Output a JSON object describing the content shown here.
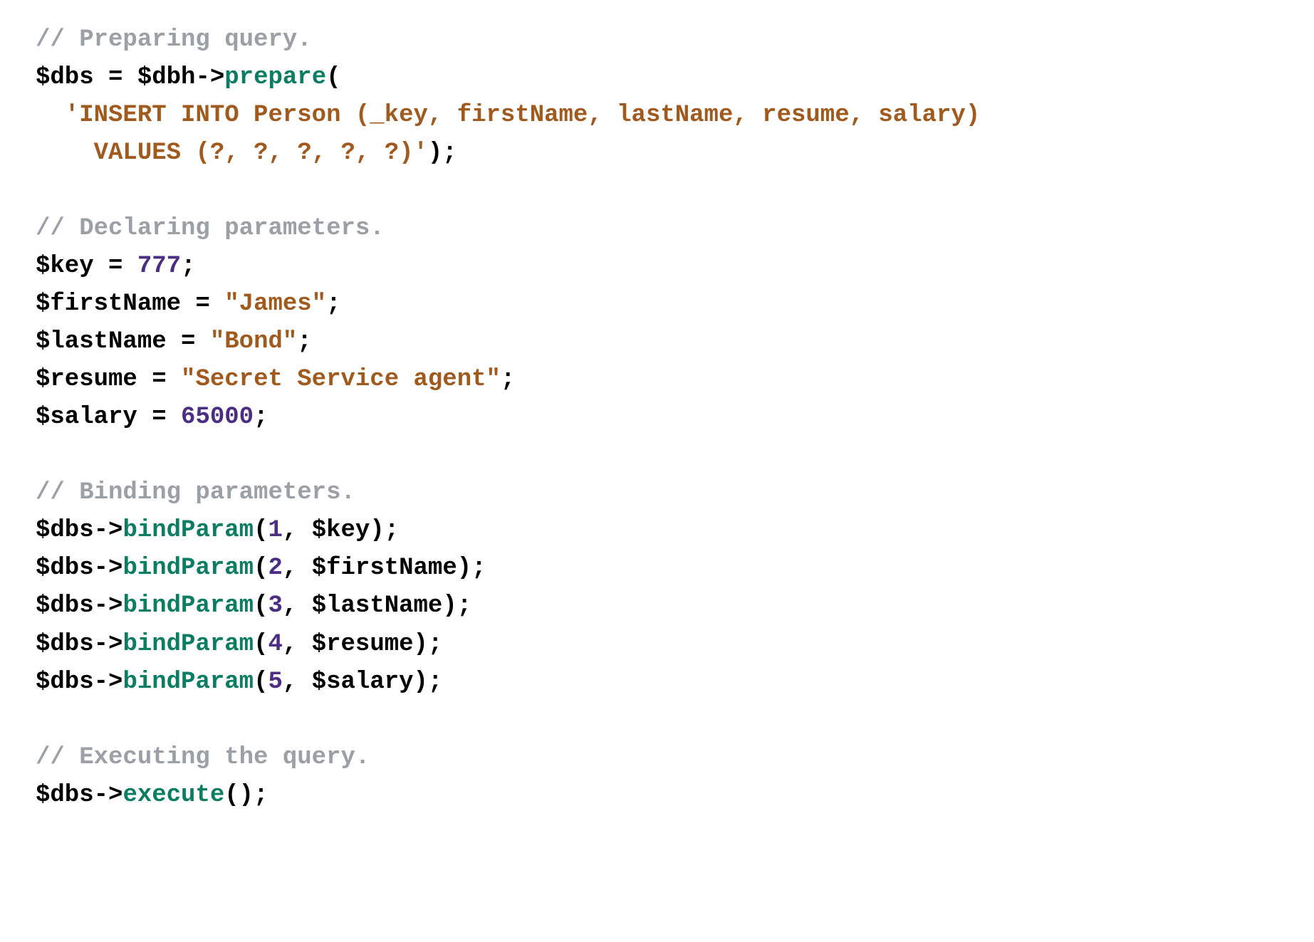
{
  "code": {
    "comments": {
      "prepare": "// Preparing query.",
      "declare": "// Declaring parameters.",
      "bind": "// Binding parameters.",
      "exec": "// Executing the query."
    },
    "vars": {
      "dbs": "$dbs",
      "dbh": "$dbh",
      "key": "$key",
      "firstName": "$firstName",
      "lastName": "$lastName",
      "resume": "$resume",
      "salary": "$salary"
    },
    "methods": {
      "prepare": "prepare",
      "bindParam": "bindParam",
      "execute": "execute"
    },
    "strings": {
      "sql_line1": "'INSERT INTO Person (_key, firstName, lastName, resume, salary)",
      "sql_line2": "VALUES (?, ?, ?, ?, ?)'",
      "james": "\"James\"",
      "bond": "\"Bond\"",
      "agent": "\"Secret Service agent\""
    },
    "numbers": {
      "n777": "777",
      "n65000": "65000",
      "n1": "1",
      "n2": "2",
      "n3": "3",
      "n4": "4",
      "n5": "5"
    },
    "punct": {
      "eq": " = ",
      "arrow": "->",
      "open": "(",
      "close": ")",
      "closesemi": ");",
      "semi": ";",
      "comma": ", "
    }
  }
}
